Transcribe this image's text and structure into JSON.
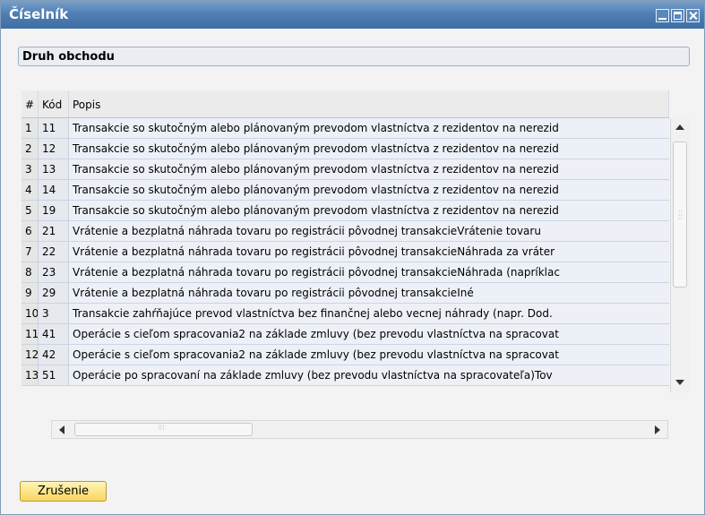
{
  "window": {
    "title": "Číselník"
  },
  "section_label": "Druh obchodu",
  "table": {
    "headers": {
      "num": "#",
      "kod": "Kód",
      "popis": "Popis"
    },
    "rows": [
      {
        "num": "1",
        "kod": "11",
        "popis": "Transakcie so skutočným alebo plánovaným prevodom vlastníctva z rezidentov na nerezid"
      },
      {
        "num": "2",
        "kod": "12",
        "popis": "Transakcie so skutočným alebo plánovaným prevodom vlastníctva z rezidentov na nerezid"
      },
      {
        "num": "3",
        "kod": "13",
        "popis": "Transakcie so skutočným alebo plánovaným prevodom vlastníctva z rezidentov na nerezid"
      },
      {
        "num": "4",
        "kod": "14",
        "popis": "Transakcie so skutočným alebo plánovaným prevodom vlastníctva z rezidentov na nerezid"
      },
      {
        "num": "5",
        "kod": "19",
        "popis": "Transakcie so skutočným alebo plánovaným prevodom vlastníctva z rezidentov na nerezid"
      },
      {
        "num": "6",
        "kod": "21",
        "popis": "Vrátenie a bezplatná náhrada tovaru po registrácii pôvodnej transakcieVrátenie tovaru"
      },
      {
        "num": "7",
        "kod": "22",
        "popis": "Vrátenie a bezplatná náhrada tovaru po registrácii pôvodnej transakcieNáhrada za vráter"
      },
      {
        "num": "8",
        "kod": "23",
        "popis": "Vrátenie a bezplatná náhrada tovaru po registrácii pôvodnej transakcieNáhrada (napríklac"
      },
      {
        "num": "9",
        "kod": "29",
        "popis": "Vrátenie a bezplatná náhrada tovaru po registrácii pôvodnej transakcieIné"
      },
      {
        "num": "10",
        "kod": "3",
        "popis": "Transakcie zahŕňajúce prevod vlastníctva bez finančnej alebo vecnej náhrady (napr. Dod."
      },
      {
        "num": "11",
        "kod": "41",
        "popis": "Operácie s cieľom spracovania2 na základe zmluvy (bez prevodu vlastníctva na spracovat"
      },
      {
        "num": "12",
        "kod": "42",
        "popis": "Operácie s cieľom spracovania2 na základe zmluvy (bez prevodu vlastníctva na spracovat"
      },
      {
        "num": "13",
        "kod": "51",
        "popis": "Operácie po spracovaní na základe zmluvy (bez prevodu vlastníctva na spracovateľa)Tov"
      }
    ]
  },
  "buttons": {
    "cancel": "Zrušenie"
  },
  "icons": {
    "minimize": "minimize-icon",
    "maximize": "maximize-icon",
    "close": "close-icon"
  },
  "colors": {
    "title_bar": "#4f7fb3",
    "cancel_button": "#f8d760"
  }
}
